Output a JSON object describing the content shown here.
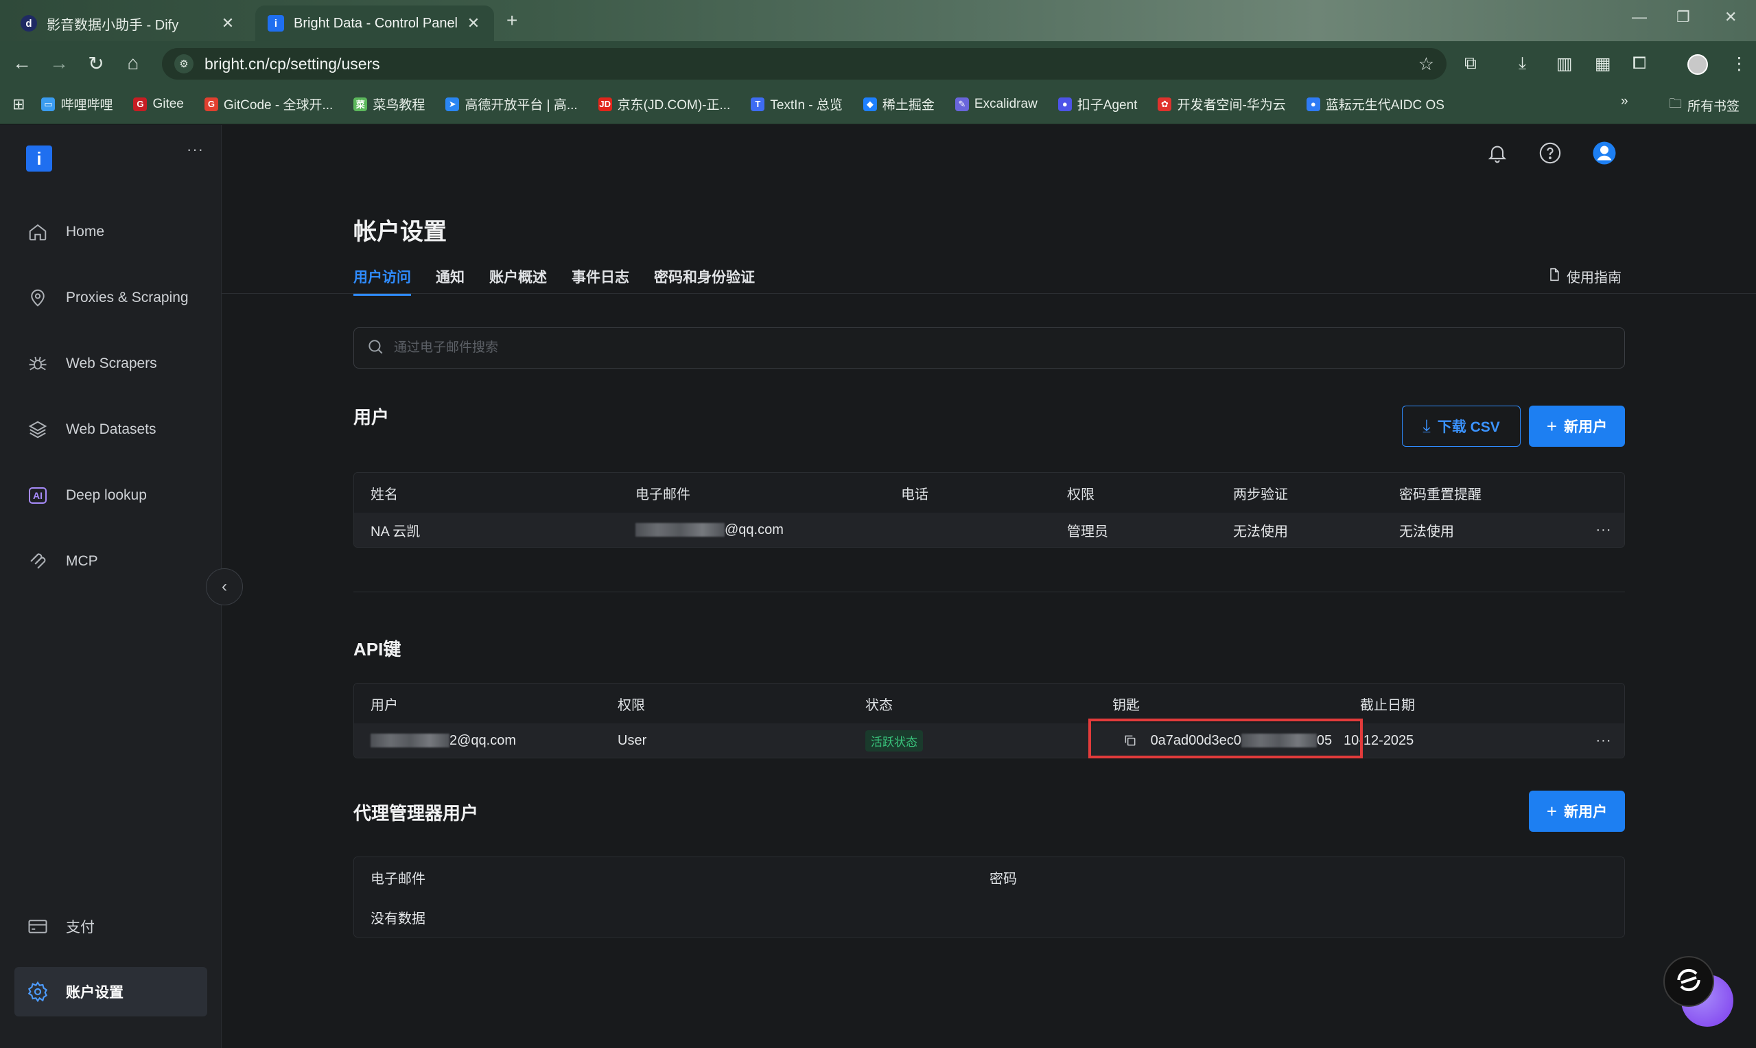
{
  "browser": {
    "tabs": [
      {
        "title": "影音数据小助手 - Dify",
        "icon": "dify-icon"
      },
      {
        "title": "Bright Data - Control Panel",
        "icon": "brightdata-icon"
      }
    ],
    "url": "bright.cn/cp/setting/users",
    "bookmarks": [
      {
        "label": "哔哩哔哩",
        "color": "#3a9cf0"
      },
      {
        "label": "Gitee",
        "color": "#c71d23"
      },
      {
        "label": "GitCode - 全球开...",
        "color": "#e0402f"
      },
      {
        "label": "菜鸟教程",
        "color": "#5cb85c"
      },
      {
        "label": "高德开放平台 | 高...",
        "color": "#2a86f3"
      },
      {
        "label": "京东(JD.COM)-正...",
        "color": "#e1251b"
      },
      {
        "label": "TextIn - 总览",
        "color": "#3e6cf2"
      },
      {
        "label": "稀土掘金",
        "color": "#1e80ff"
      },
      {
        "label": "Excalidraw",
        "color": "#6965db"
      },
      {
        "label": "扣子Agent",
        "color": "#4d53e8"
      },
      {
        "label": "开发者空间-华为云",
        "color": "#e0322d"
      },
      {
        "label": "蓝耘元生代AIDC OS",
        "color": "#2f7bf5"
      }
    ],
    "more_bookmarks": "»",
    "all_bookmarks": "所有书签"
  },
  "sidebar": {
    "logo_letter": "i",
    "more": "···",
    "items": [
      {
        "label": "Home",
        "icon": "home-icon"
      },
      {
        "label": "Proxies & Scraping",
        "icon": "location-pin-icon"
      },
      {
        "label": "Web Scrapers",
        "icon": "spider-icon"
      },
      {
        "label": "Web Datasets",
        "icon": "layers-icon"
      },
      {
        "label": "Deep lookup",
        "icon": "ai-icon",
        "icon_text": "AI"
      },
      {
        "label": "MCP",
        "icon": "mcp-icon"
      }
    ],
    "bottom_items": [
      {
        "label": "支付",
        "icon": "card-icon"
      },
      {
        "label": "账户设置",
        "icon": "gear-icon",
        "selected": true
      }
    ]
  },
  "page": {
    "title": "帐户设置",
    "tabs": [
      "用户访问",
      "通知",
      "账户概述",
      "事件日志",
      "密码和身份验证"
    ],
    "active_tab": "用户访问",
    "guide": "使用指南",
    "search_placeholder": "通过电子邮件搜索"
  },
  "users": {
    "heading": "用户",
    "download_csv": "下载 CSV",
    "new_user": "新用户",
    "columns": [
      "姓名",
      "电子邮件",
      "电话",
      "权限",
      "两步验证",
      "密码重置提醒"
    ],
    "rows": [
      {
        "name": "NA 云凯",
        "email_suffix": "@qq.com",
        "phone": "",
        "role": "管理员",
        "two_factor": "无法使用",
        "reset_reminder": "无法使用"
      }
    ]
  },
  "api_keys": {
    "heading": "API键",
    "columns": [
      "用户",
      "权限",
      "状态",
      "钥匙",
      "截止日期"
    ],
    "rows": [
      {
        "user_suffix": "2@qq.com",
        "role": "User",
        "status": "活跃状态",
        "key_prefix": "0a7ad00d3ec0",
        "key_suffix": "05",
        "expiry": "10-12-2025"
      }
    ]
  },
  "proxy_users": {
    "heading": "代理管理器用户",
    "new_user": "新用户",
    "columns": [
      "电子邮件",
      "密码"
    ],
    "empty": "没有数据"
  },
  "colors": {
    "accent": "#1d7ff2",
    "active_status": "#38c07a",
    "highlight_box": "#e23b3b"
  }
}
